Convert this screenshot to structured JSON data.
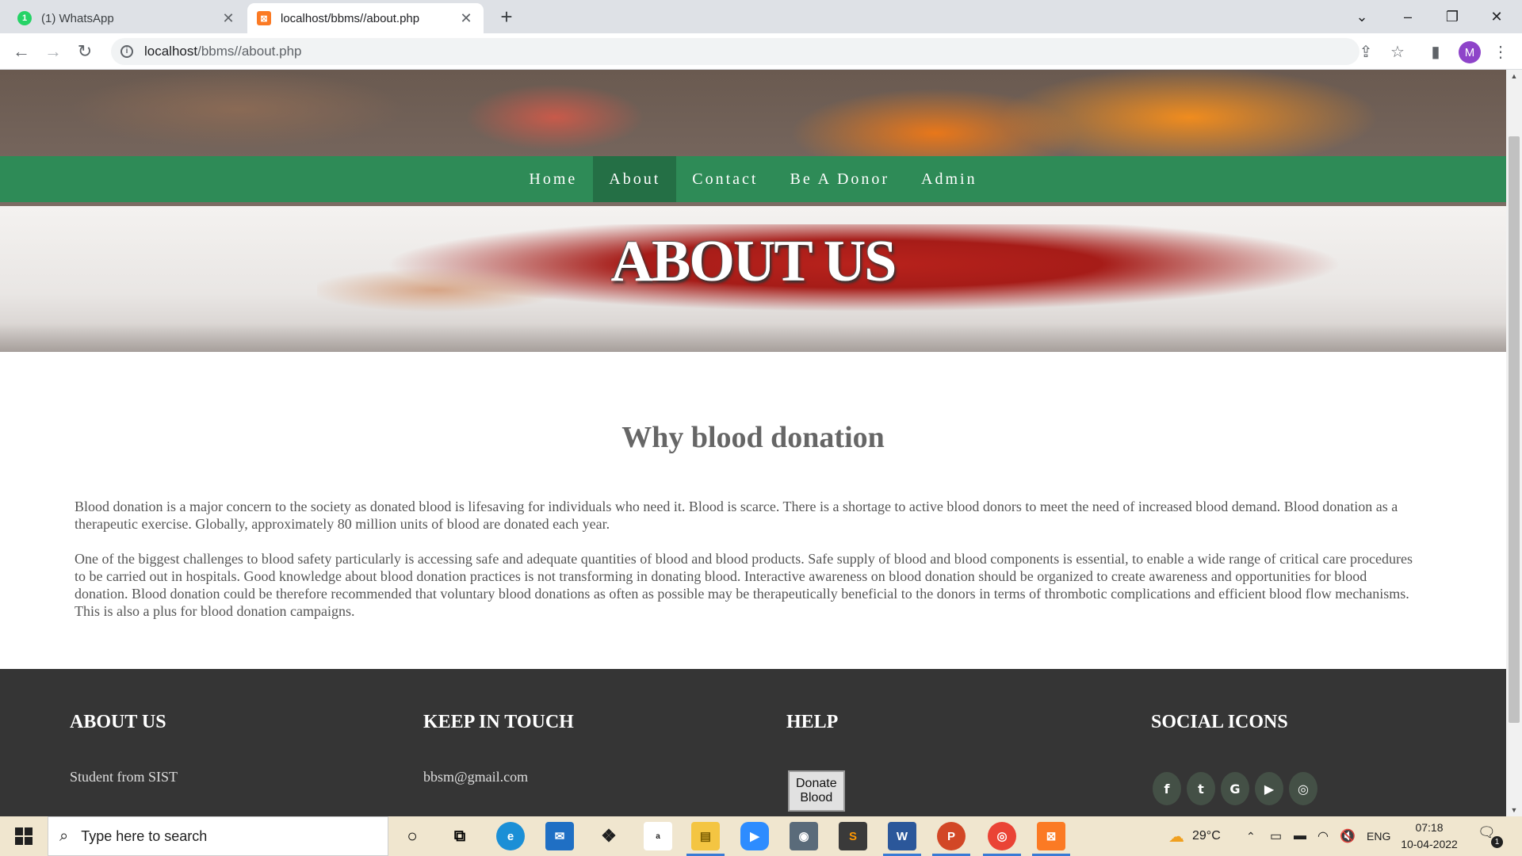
{
  "browser": {
    "tabs": [
      {
        "title": "(1) WhatsApp",
        "favicon": "whatsapp-icon",
        "badge": "1",
        "active": false
      },
      {
        "title": "localhost/bbms//about.php",
        "favicon": "xampp-icon",
        "badge": "",
        "active": true
      }
    ],
    "url_host": "localhost",
    "url_path": "/bbms//about.php",
    "profile_initial": "M",
    "icons": {
      "back": "back-arrow-icon",
      "forward": "forward-arrow-icon",
      "reload": "reload-icon",
      "share": "share-icon",
      "bookmark": "star-icon",
      "sidepanel": "side-panel-icon",
      "menu": "kebab-menu-icon"
    }
  },
  "site": {
    "nav": {
      "items": [
        "Home",
        "About",
        "Contact",
        "Be A Donor",
        "Admin"
      ],
      "active": "About"
    },
    "hero_title": "ABOUT US",
    "heading": "Why blood donation",
    "paragraphs": [
      "Blood donation is a major concern to the society as donated blood is lifesaving for individuals who need it. Blood is scarce. There is a shortage to active blood donors to meet the need of increased blood demand. Blood donation as a therapeutic exercise. Globally, approximately 80 million units of blood are donated each year.",
      "One of the biggest challenges to blood safety particularly is accessing safe and adequate quantities of blood and blood products. Safe supply of blood and blood components is essential, to enable a wide range of critical care procedures to be carried out in hospitals. Good knowledge about blood donation practices is not transforming in donating blood. Interactive awareness on blood donation should be organized to create awareness and opportunities for blood donation. Blood donation could be therefore recommended that voluntary blood donations as often as possible may be therapeutically beneficial to the donors in terms of thrombotic complications and efficient blood flow mechanisms. This is also a plus for blood donation campaigns."
    ],
    "footer": {
      "about_title": "ABOUT US",
      "about_text": "Student from SIST",
      "touch_title": "KEEP IN TOUCH",
      "touch_text": "bbsm@gmail.com",
      "help_title": "HELP",
      "help_button": "Donate Blood",
      "social_title": "SOCIAL ICONS",
      "social_icons": [
        "facebook-icon",
        "twitter-icon",
        "google-icon",
        "youtube-icon",
        "instagram-icon"
      ]
    },
    "colors": {
      "nav_bg": "#2e8b57",
      "nav_active_bg": "#246f45",
      "footer_bg": "#353535",
      "heading_color": "#666666"
    }
  },
  "taskbar": {
    "search_placeholder": "Type here to search",
    "apps": [
      "cortana-icon",
      "task-view-icon",
      "edge-icon",
      "mail-icon",
      "dropbox-icon",
      "amazon-icon",
      "file-explorer-icon",
      "zoom-icon",
      "camera-icon",
      "sublime-text-icon",
      "word-icon",
      "powerpoint-icon",
      "chrome-icon",
      "xampp-icon"
    ],
    "weather": "29°C",
    "language": "ENG",
    "time": "07:18",
    "date": "10-04-2022",
    "notification_count": "1"
  }
}
